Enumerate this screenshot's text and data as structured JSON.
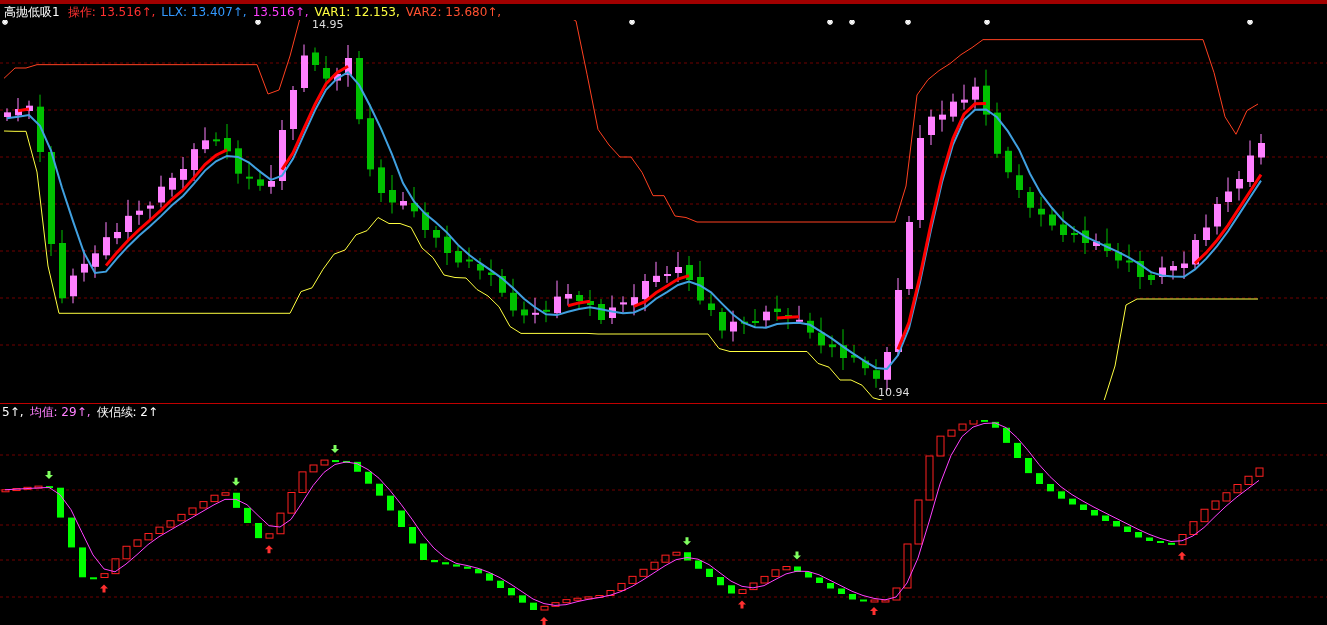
{
  "title": "高抛低吸1",
  "legend": [
    {
      "text": "操作: 13.516↑,",
      "color": "#ff3030"
    },
    {
      "text": "LLX: 13.407↑,",
      "color": "#3399ff"
    },
    {
      "text": "13.516↑,",
      "color": "#ff40ff"
    },
    {
      "text": "VAR1: 12.153,",
      "color": "#ffff40"
    },
    {
      "text": "VAR2: 13.680↑,",
      "color": "#ff5030"
    }
  ],
  "high_label": "14.95",
  "low_label": "10.94",
  "indicator_legend": [
    {
      "text": "5↑,",
      "color": "#ffffff"
    },
    {
      "text": "均值: 29↑,",
      "color": "#ff80ff"
    },
    {
      "text": "侠侣续: 2↑",
      "color": "#ffffff"
    }
  ]
}
